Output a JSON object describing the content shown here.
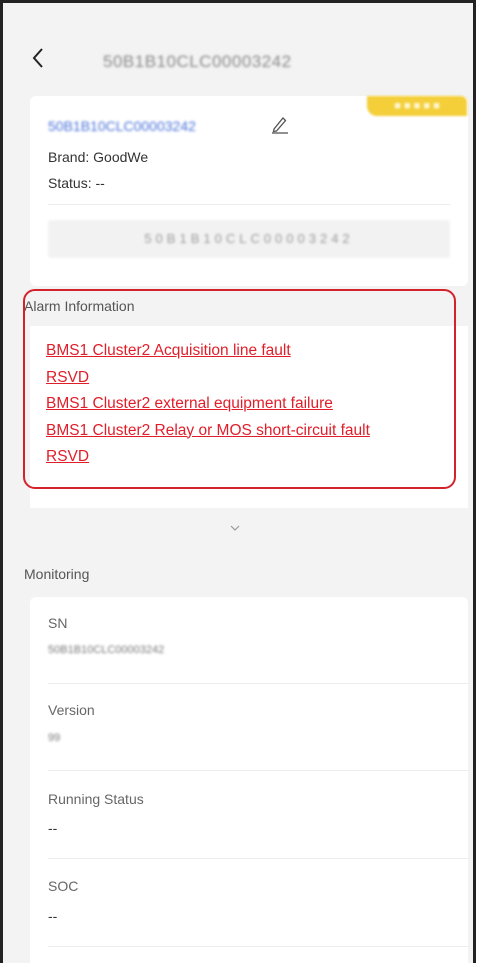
{
  "header": {
    "title": "50B1B10CLC00003242"
  },
  "device": {
    "sn_link": "50B1B10CLC00003242",
    "badge": "■ ■ ■ ■ ■",
    "brand": "Brand: GoodWe",
    "status": "Status: --",
    "barcode": "50B1B10CLC00003242"
  },
  "alarm": {
    "heading": "Alarm Information",
    "items": [
      "BMS1 Cluster2 Acquisition line fault",
      "RSVD",
      "BMS1 Cluster2 external equipment failure",
      "BMS1 Cluster2 Relay or MOS short-circuit fault",
      "RSVD"
    ]
  },
  "monitoring": {
    "heading": "Monitoring",
    "fields": [
      {
        "label": "SN",
        "value": "50B1B10CLC00003242"
      },
      {
        "label": "Version",
        "value": "99"
      },
      {
        "label": "Running Status",
        "value": "--"
      },
      {
        "label": "SOC",
        "value": "--"
      }
    ]
  },
  "colors": {
    "alarm_red": "#e01e2a",
    "link_blue": "#4a72d8",
    "badge_yellow": "#f4cf3a",
    "highlight_border": "#d4222b"
  }
}
